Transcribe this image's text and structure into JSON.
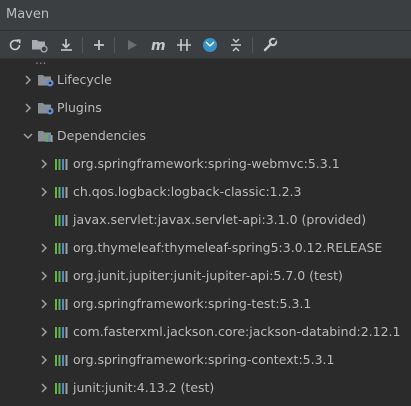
{
  "window": {
    "title": "Maven"
  },
  "toolbar": {
    "buttons": [
      {
        "name": "reload-icon"
      },
      {
        "name": "add-maven-project-icon"
      },
      {
        "name": "download-sources-icon"
      },
      {
        "name": "add-icon"
      },
      {
        "name": "run-icon"
      },
      {
        "name": "execute-maven-goal-icon"
      },
      {
        "name": "toggle-offline-icon"
      },
      {
        "name": "skip-tests-icon"
      },
      {
        "name": "collapse-all-icon"
      },
      {
        "name": "settings-icon"
      }
    ]
  },
  "tree": {
    "sections": [
      {
        "label": "Lifecycle"
      },
      {
        "label": "Plugins"
      },
      {
        "label": "Dependencies"
      }
    ],
    "dependencies": [
      {
        "label": "org.springframework:spring-webmvc:5.3.1",
        "expandable": true
      },
      {
        "label": "ch.qos.logback:logback-classic:1.2.3",
        "expandable": true
      },
      {
        "label": "javax.servlet:javax.servlet-api:3.1.0 (provided)",
        "expandable": false
      },
      {
        "label": "org.thymeleaf:thymeleaf-spring5:3.0.12.RELEASE",
        "expandable": true
      },
      {
        "label": "org.junit.jupiter:junit-jupiter-api:5.7.0 (test)",
        "expandable": true
      },
      {
        "label": "org.springframework:spring-test:5.3.1",
        "expandable": true
      },
      {
        "label": "com.fasterxml.jackson.core:jackson-databind:2.12.1",
        "expandable": true
      },
      {
        "label": "org.springframework:spring-context:5.3.1",
        "expandable": true
      },
      {
        "label": "junit:junit:4.13.2 (test)",
        "expandable": true
      }
    ]
  },
  "colors": {
    "panel_bg": "#2b2b2b",
    "toolbar_bg": "#3c3f41",
    "text": "#bbbbbb",
    "folder_icon": "#8a8f94",
    "gear_icon": "#5f8fcf",
    "lib_icon_green": "#62b543",
    "lib_icon_blue": "#4b8bc7",
    "lib_icon_gray": "#9aa0a6"
  }
}
